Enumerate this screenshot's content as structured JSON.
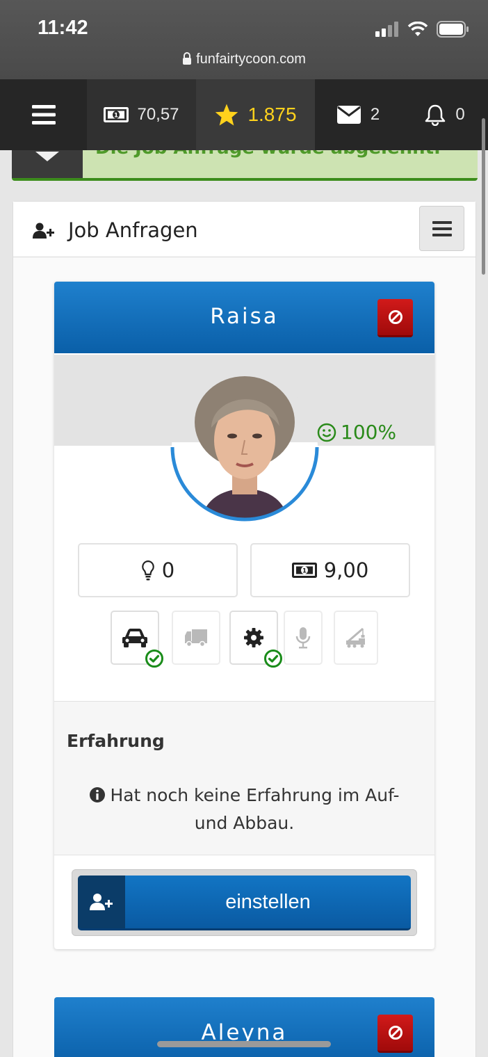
{
  "status_bar": {
    "time": "11:42",
    "url": "funfairtycoon.com"
  },
  "top_nav": {
    "money": "70,57",
    "stars": "1.875",
    "messages": "2",
    "notifications": "0"
  },
  "notice": {
    "text": "Die Job Anfrage wurde abgelehnt."
  },
  "panel": {
    "title": "Job Anfragen"
  },
  "applicants": [
    {
      "name": "Raisa",
      "satisfaction": "100%",
      "skill": "0",
      "wage": "9,00",
      "licenses": [
        {
          "icon": "car-icon",
          "active": true
        },
        {
          "icon": "truck-icon",
          "active": false
        },
        {
          "icon": "gear-icon",
          "active": true
        },
        {
          "icon": "microphone-icon",
          "active": false
        },
        {
          "icon": "crane-icon",
          "active": false
        }
      ],
      "experience_title": "Erfahrung",
      "experience_text": "Hat noch keine Erfahrung im Auf- und Abbau.",
      "hire_label": "einstellen"
    },
    {
      "name": "Aleyna"
    }
  ],
  "colors": {
    "header_blue": "#0a5fa8",
    "reject_red": "#c01010",
    "ok_green": "#2a8a1a",
    "star_yellow": "#ffd21c"
  }
}
